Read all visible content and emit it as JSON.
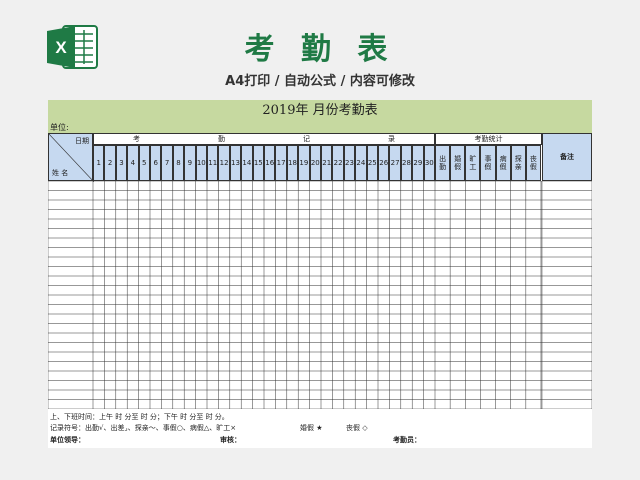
{
  "header": {
    "title": "考 勤 表",
    "subtitle": "A4打印 / 自动公式 / 内容可修改"
  },
  "sheet": {
    "title": "2019年      月份考勤表",
    "unit_label": "单位:",
    "corner_top": "日期",
    "corner_bottom": "姓 名",
    "attendance_group": [
      "考",
      "勤",
      "记",
      "录"
    ],
    "stats_group": "考勤统计",
    "days": [
      "1",
      "2",
      "3",
      "4",
      "5",
      "6",
      "7",
      "8",
      "9",
      "10",
      "11",
      "12",
      "13",
      "14",
      "15",
      "16",
      "17",
      "18",
      "19",
      "20",
      "21",
      "22",
      "23",
      "24",
      "25",
      "26",
      "27",
      "28",
      "29",
      "30"
    ],
    "stat_columns": [
      "出勤",
      "婚假",
      "旷工",
      "事假",
      "病假",
      "探亲",
      "丧假"
    ],
    "remark": "备注",
    "body_rows": 24
  },
  "footer": {
    "time_line": "上、下班时间：上午      时       分至       时       分；下午       时       分至       时       分。",
    "symbols_line": "记录符号：出勤√、出差⌟、探亲～、事假○、病假△、旷工×",
    "marriage_leave": "婚假   ★",
    "funeral_leave": "丧假   ◇",
    "leader_label": "单位领导：",
    "review_label": "审核：",
    "clerk_label": "考勤员："
  }
}
